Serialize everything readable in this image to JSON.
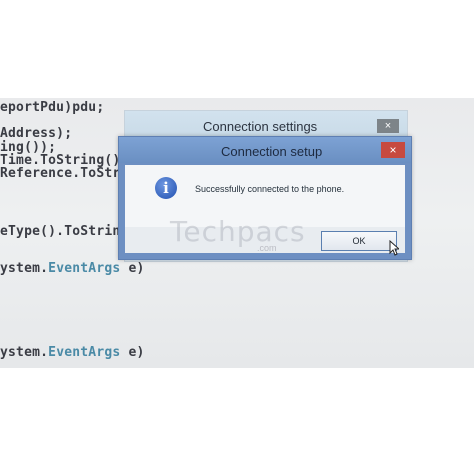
{
  "code": {
    "lines": [
      "eportPdu)pdu;",
      "Address);",
      "ing());",
      "Time.ToString()",
      "Reference.ToStri",
      "eType().ToString(",
      "ystem.",
      "EventArgs",
      " e)",
      "ystem.",
      "EventArgs",
      " e)"
    ]
  },
  "back_window": {
    "title": "Connection settings",
    "close_glyph": "×"
  },
  "dialog": {
    "title": "Connection setup",
    "close_glyph": "×",
    "icon_glyph": "i",
    "message": "Successfully connected to the phone.",
    "ok_label": "OK"
  },
  "watermark": {
    "text": "Techpacs",
    "sub": ".com"
  },
  "colors": {
    "dialog_frame": "#6d8fc2",
    "close_button": "#c74a3f",
    "info_icon": "#1f4fb0",
    "code_keyword": "#4a8aa6"
  }
}
